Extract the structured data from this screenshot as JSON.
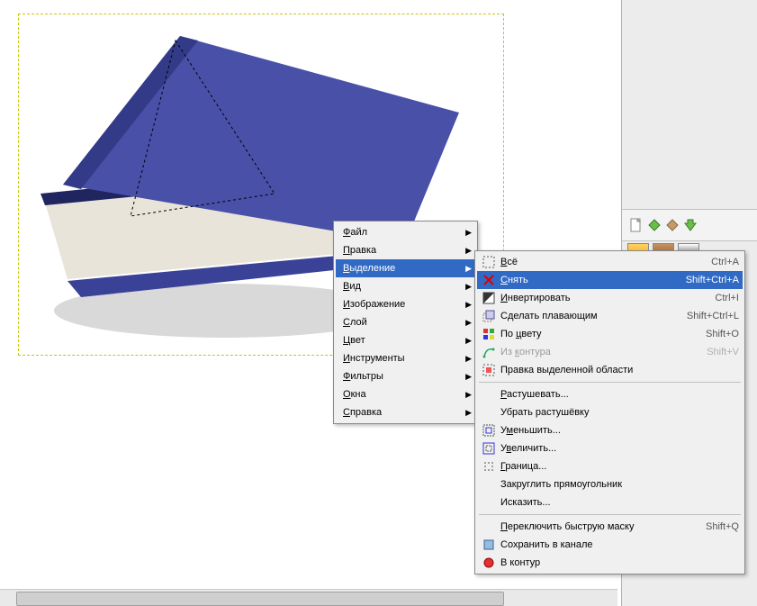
{
  "menu_main": [
    {
      "label": "Файл",
      "underline": 0,
      "arrow": true
    },
    {
      "label": "Правка",
      "underline": 0,
      "arrow": true
    },
    {
      "label": "Выделение",
      "underline": 0,
      "arrow": true,
      "highlight": true
    },
    {
      "label": "Вид",
      "underline": 0,
      "arrow": true
    },
    {
      "label": "Изображение",
      "underline": 0,
      "arrow": true
    },
    {
      "label": "Слой",
      "underline": 0,
      "arrow": true
    },
    {
      "label": "Цвет",
      "underline": 0,
      "arrow": true
    },
    {
      "label": "Инструменты",
      "underline": 0,
      "arrow": true
    },
    {
      "label": "Фильтры",
      "underline": 0,
      "arrow": true
    },
    {
      "label": "Окна",
      "underline": 0,
      "arrow": true
    },
    {
      "label": "Справка",
      "underline": 0,
      "arrow": true
    }
  ],
  "menu_sub": [
    {
      "icon": "select-all",
      "label": "Всё",
      "underline": 0,
      "shortcut": "Ctrl+A"
    },
    {
      "icon": "none-red",
      "label": "Снять",
      "underline": 0,
      "shortcut": "Shift+Ctrl+A",
      "highlight": true
    },
    {
      "icon": "invert",
      "label": "Инвертировать",
      "underline": 0,
      "shortcut": "Ctrl+I"
    },
    {
      "icon": "float",
      "label": "Сделать плавающим",
      "underline": -1,
      "shortcut": "Shift+Ctrl+L"
    },
    {
      "icon": "bycolor",
      "label": "По цвету",
      "underline": 3,
      "shortcut": "Shift+O"
    },
    {
      "icon": "path",
      "label": "Из контура",
      "underline": 3,
      "shortcut": "Shift+V",
      "disabled": true
    },
    {
      "icon": "editor",
      "label": "Правка выделенной области",
      "underline": -1
    },
    {
      "sep": true
    },
    {
      "label": "Растушевать...",
      "underline": 0
    },
    {
      "label": "Убрать растушёвку",
      "underline": -1
    },
    {
      "icon": "shrink",
      "label": "Уменьшить...",
      "underline": 1
    },
    {
      "icon": "grow",
      "label": "Увеличить...",
      "underline": 1
    },
    {
      "icon": "border",
      "label": "Граница...",
      "underline": 0
    },
    {
      "label": "Закруглить прямоугольник",
      "underline": -1
    },
    {
      "label": "Исказить...",
      "underline": -1
    },
    {
      "sep": true
    },
    {
      "label": "Переключить быструю маску",
      "underline": 0,
      "shortcut": "Shift+Q"
    },
    {
      "icon": "channel",
      "label": "Сохранить в канале",
      "underline": -1
    },
    {
      "icon": "topath",
      "label": "В контур",
      "underline": -1
    }
  ],
  "toolbar_icons": [
    "doc-new-icon",
    "diamond-green-icon",
    "diamond-brown-icon",
    "arrow-down-green-icon"
  ],
  "swatches": [
    "#f7b733",
    "#a06a30",
    "#000000"
  ]
}
